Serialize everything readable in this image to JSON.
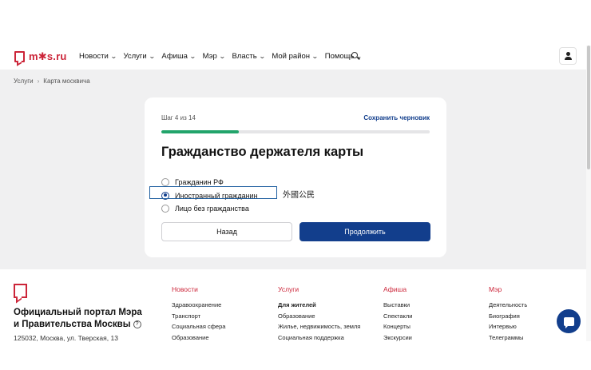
{
  "header": {
    "logo_text": "m✱s.ru",
    "nav": [
      "Новости",
      "Услуги",
      "Афиша",
      "Мэр",
      "Власть",
      "Мой район",
      "Помощь"
    ]
  },
  "breadcrumb": [
    "Услуги",
    "Карта москвича"
  ],
  "form": {
    "step": "Шаг 4 из 14",
    "save_draft": "Сохранить черновик",
    "progress": 0.29,
    "title": "Гражданство держателя карты",
    "options": [
      "Гражданин РФ",
      "Иностранный гражданин",
      "Лицо без гражданства"
    ],
    "selected_option": "Иностранный гражданин",
    "annotation": "外國公民",
    "back_label": "Назад",
    "next_label": "Продолжить"
  },
  "footer": {
    "org_line1": "Официальный портал Мэра",
    "org_line2": "и Правительства Москвы",
    "address": "125032, Москва, ул. Тверская, 13",
    "columns": [
      {
        "title": "Новости",
        "links": [
          "Здравоохранение",
          "Транспорт",
          "Социальная сфера",
          "Образование"
        ]
      },
      {
        "title": "Услуги",
        "links": [
          "Для жителей",
          "Образование",
          "Жилье, недвижимость, земля",
          "Социальная поддержка"
        ]
      },
      {
        "title": "Афиша",
        "links": [
          "Выставки",
          "Спектакли",
          "Концерты",
          "Экскурсии"
        ]
      },
      {
        "title": "Мэр",
        "links": [
          "Деятельность",
          "Биография",
          "Интервью",
          "Телеграммы"
        ]
      }
    ]
  },
  "colors": {
    "brand_red": "#cc2539",
    "primary_blue": "#123e8c",
    "progress_green": "#22a46b"
  }
}
